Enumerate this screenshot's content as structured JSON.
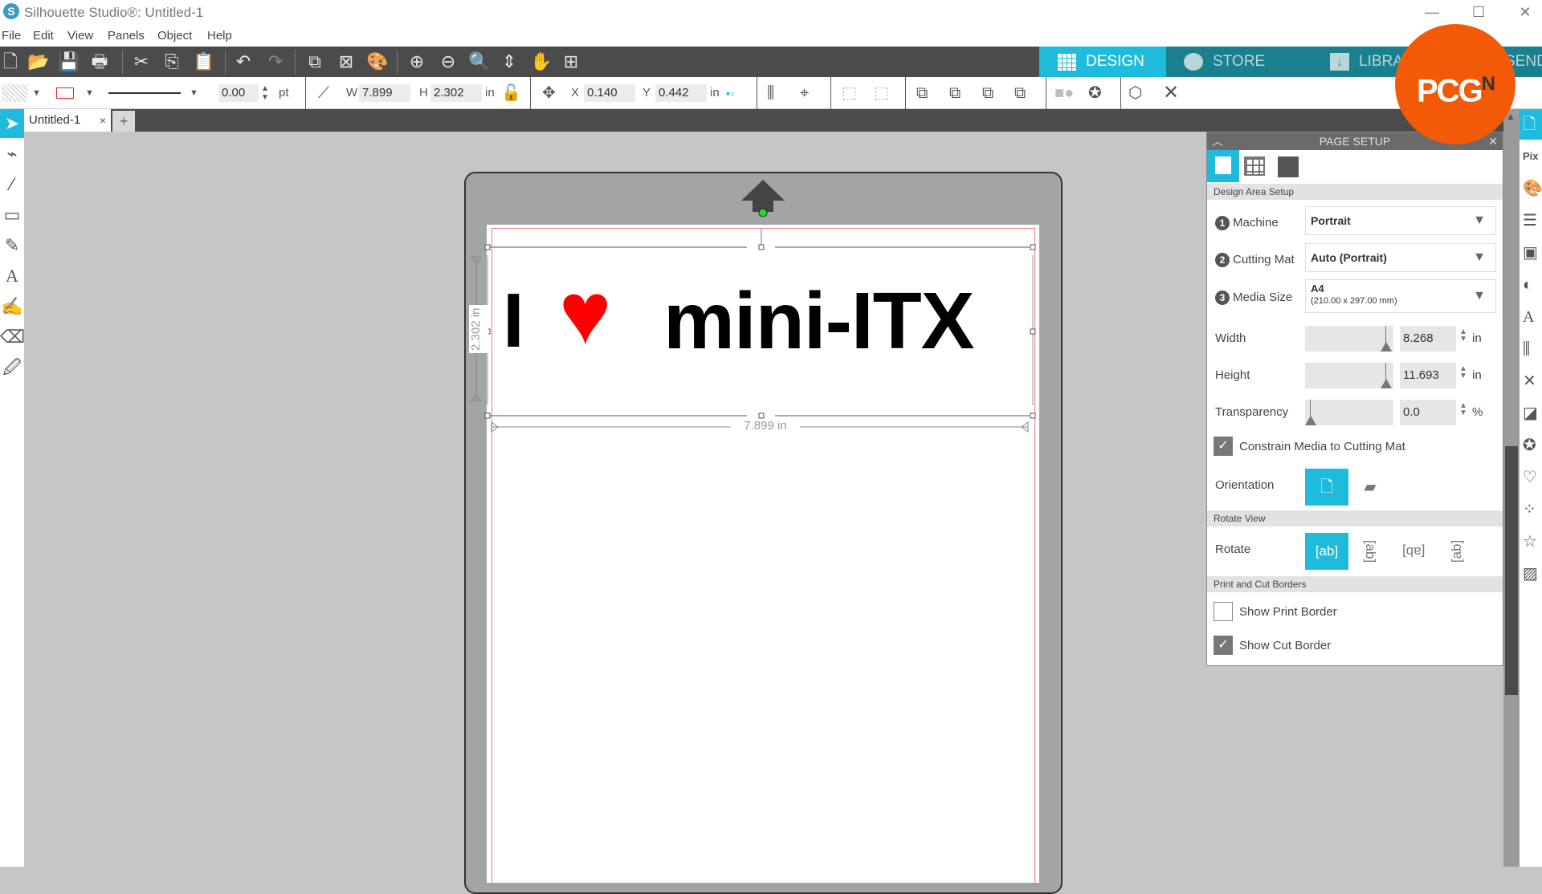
{
  "window": {
    "title": "Silhouette Studio®: Untitled-1",
    "app_icon": "silhouette-logo"
  },
  "menu": [
    "File",
    "Edit",
    "View",
    "Panels",
    "Object",
    "Help"
  ],
  "nav_tabs": [
    {
      "label": "DESIGN",
      "icon": "grid-icon",
      "active": true
    },
    {
      "label": "STORE",
      "icon": "silhouette-s-icon",
      "active": false
    },
    {
      "label": "LIBRARY",
      "icon": "download-folder-icon",
      "active": false
    },
    {
      "label": "SEND",
      "icon": "send-icon",
      "active": false
    }
  ],
  "toolbar2": {
    "line_width": "0.00",
    "line_unit": "pt",
    "w_label": "W",
    "w_value": "7.899",
    "h_label": "H",
    "h_value": "2.302",
    "size_unit": "in",
    "x_label": "X",
    "x_value": "0.140",
    "y_label": "Y",
    "y_value": "0.442",
    "pos_unit": "in"
  },
  "doc_tab": {
    "label": "Untitled-1",
    "close": "×",
    "add": "+"
  },
  "canvas": {
    "design_text_1": "I",
    "design_heart": "♥",
    "design_text_2": "mini-ITX",
    "height_dim": "2.302 in",
    "width_dim": "7.899 in"
  },
  "panel": {
    "title": "PAGE SETUP",
    "section_design_area": "Design Area Setup",
    "machine": {
      "num": "1",
      "label": "Machine",
      "value": "Portrait"
    },
    "cutting_mat": {
      "num": "2",
      "label": "Cutting Mat",
      "value": "Auto (Portrait)"
    },
    "media_size": {
      "num": "3",
      "label": "Media Size",
      "value": "A4",
      "sub": "(210.00 x 297.00 mm)"
    },
    "width": {
      "label": "Width",
      "value": "8.268",
      "unit": "in",
      "slider_fraction": 0.85
    },
    "height": {
      "label": "Height",
      "value": "11.693",
      "unit": "in",
      "slider_fraction": 0.85
    },
    "transparency": {
      "label": "Transparency",
      "value": "0.0",
      "unit": "%",
      "slider_fraction": 0.0
    },
    "constrain": {
      "label": "Constrain Media to Cutting Mat",
      "checked": true
    },
    "orientation": {
      "label": "Orientation",
      "selected": "portrait"
    },
    "section_rotate": "Rotate View",
    "rotate": {
      "label": "Rotate",
      "selected": 0,
      "options": [
        "ab",
        "ab-90",
        "ab-180",
        "ab-270"
      ]
    },
    "section_borders": "Print and Cut Borders",
    "show_print_border": {
      "label": "Show Print Border",
      "checked": false
    },
    "show_cut_border": {
      "label": "Show Cut Border",
      "checked": true
    }
  },
  "watermark": {
    "text": "PCG",
    "sup": "N"
  },
  "colors": {
    "accent": "#1fbbdc",
    "nav_dark": "#1a7f8e",
    "toolbar": "#4b4b4b",
    "heart": "#ff0000",
    "watermark": "#f35a08"
  }
}
